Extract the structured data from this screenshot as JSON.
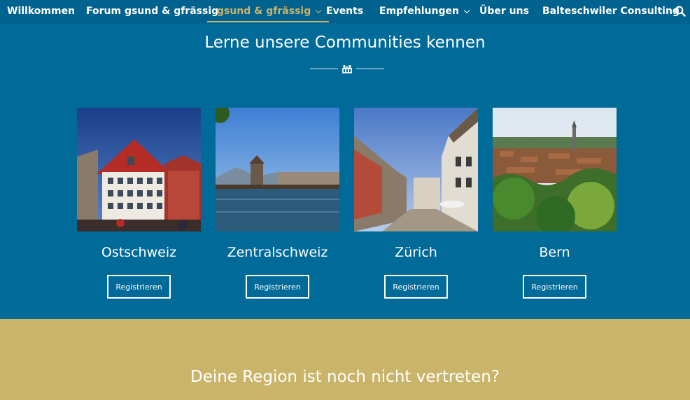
{
  "nav": {
    "items": [
      {
        "label": "Willkommen"
      },
      {
        "label": "Forum gsund & gfrässig"
      },
      {
        "label": "gsund & gfrässig"
      },
      {
        "label": "Events"
      },
      {
        "label": "Empfehlungen"
      },
      {
        "label": "Über uns"
      },
      {
        "label": "Balteschwiler Consulting"
      }
    ],
    "active_index": 2,
    "search_icon": "search-icon"
  },
  "section": {
    "title": "Lerne unsere Communities kennen"
  },
  "communities": [
    {
      "name": "Ostschweiz",
      "button": "Registrieren"
    },
    {
      "name": "Zentralschweiz",
      "button": "Registrieren"
    },
    {
      "name": "Zürich",
      "button": "Registrieren"
    },
    {
      "name": "Bern",
      "button": "Registrieren"
    }
  ],
  "cta": {
    "title": "Deine Region ist noch nicht vertreten?"
  },
  "colors": {
    "primary_blue": "#006a99",
    "accent_gold": "#c9b46a"
  }
}
